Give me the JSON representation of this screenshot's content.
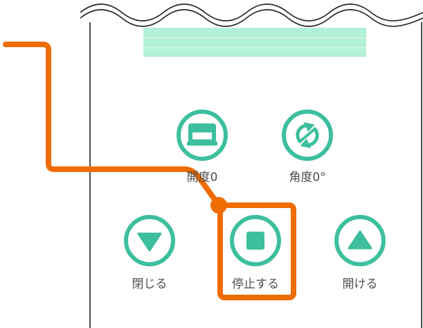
{
  "controls": {
    "open_degree_label": "開度0",
    "angle_label": "角度0°",
    "close_label": "閉じる",
    "stop_label": "停止する",
    "open_label": "開ける"
  },
  "icons": {
    "open_degree": "blind-icon",
    "angle": "rotate-arrows-icon",
    "close": "triangle-down-icon",
    "stop": "stop-square-icon",
    "open": "triangle-up-icon"
  },
  "colors": {
    "teal": "#3dbf9d",
    "curtain": "#b3f0d8",
    "highlight": "#ef6c00",
    "text": "#4d4d4d",
    "outline": "#222222"
  }
}
